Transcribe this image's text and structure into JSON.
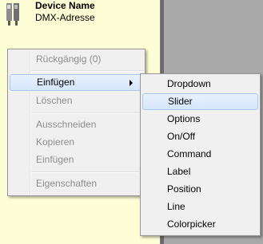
{
  "device": {
    "name": "Device Name",
    "subtitle": "DMX-Adresse"
  },
  "context_menu": {
    "items": [
      {
        "label": "Rückgängig (0)",
        "enabled": false
      },
      {
        "label": "Einfügen",
        "enabled": true,
        "has_submenu": true,
        "highlighted": true
      },
      {
        "label": "Löschen",
        "enabled": false
      },
      {
        "label": "Ausschneiden",
        "enabled": false
      },
      {
        "label": "Kopieren",
        "enabled": false
      },
      {
        "label": "Einfügen",
        "enabled": false
      },
      {
        "label": "Eigenschaften",
        "enabled": false
      }
    ]
  },
  "submenu": {
    "items": [
      {
        "label": "Dropdown"
      },
      {
        "label": "Slider",
        "highlighted": true
      },
      {
        "label": "Options"
      },
      {
        "label": "On/Off"
      },
      {
        "label": "Command"
      },
      {
        "label": "Label"
      },
      {
        "label": "Position"
      },
      {
        "label": "Line"
      },
      {
        "label": "Colorpicker"
      }
    ]
  },
  "colors": {
    "panel_background": "#fefed6",
    "desktop_background": "#a9a9a9",
    "menu_background": "#f0f0f0",
    "highlight": "#d5e6fb"
  },
  "icons": {
    "device": "device-fixture-icon",
    "submenu_arrow": "chevron-right-icon"
  }
}
